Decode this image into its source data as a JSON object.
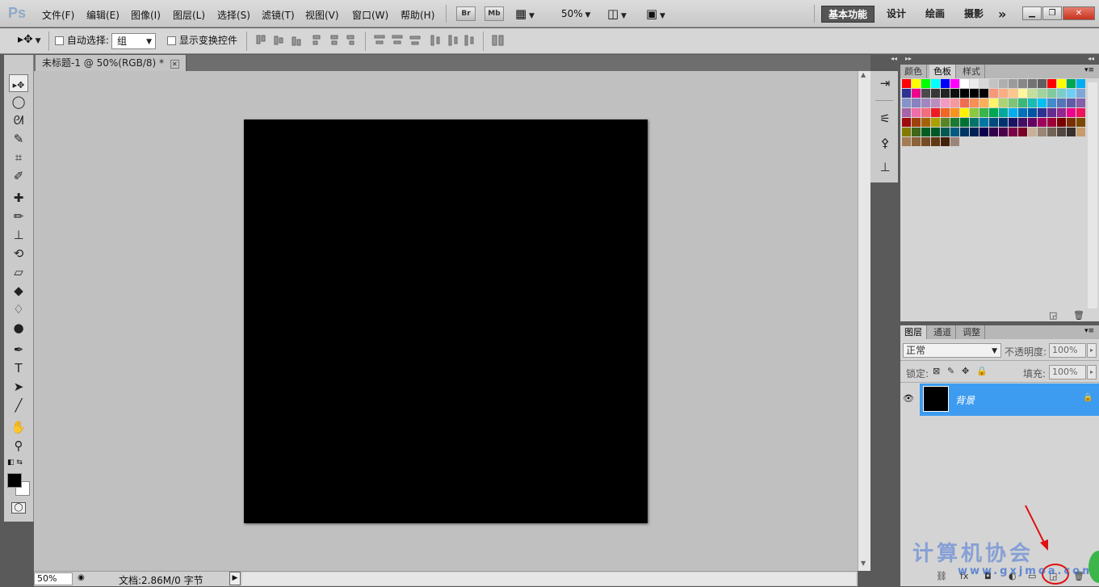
{
  "app": {
    "logo": "Ps"
  },
  "menu": [
    "文件(F)",
    "编辑(E)",
    "图像(I)",
    "图层(L)",
    "选择(S)",
    "滤镜(T)",
    "视图(V)",
    "窗口(W)",
    "帮助(H)"
  ],
  "menubar_tools": {
    "bridge": "Br",
    "mini_bridge": "Mb",
    "zoom": "50%"
  },
  "workspaces": [
    "基本功能",
    "设计",
    "绘画",
    "摄影"
  ],
  "workspace_more": "»",
  "options": {
    "auto_select_label": "自动选择:",
    "auto_select_value": "组",
    "show_transform_label": "显示变换控件"
  },
  "document": {
    "tab_label": "未标题-1 @ 50%(RGB/8) *",
    "tab_close": "✕"
  },
  "status": {
    "zoom": "50%",
    "doc_info": "文档:2.86M/0 字节"
  },
  "panels": {
    "swatch_tabs": [
      "颜色",
      "色板",
      "样式"
    ],
    "layers_tabs": [
      "图层",
      "通道",
      "调整"
    ],
    "blend_mode": "正常",
    "opacity_label": "不透明度:",
    "opacity_value": "100%",
    "lock_label": "锁定:",
    "fill_label": "填充:",
    "fill_value": "100%",
    "layer_name": "背景"
  },
  "swatch_colors": [
    "#ff0000",
    "#ffff00",
    "#00ff00",
    "#00ffff",
    "#0000ff",
    "#ff00ff",
    "#ffffff",
    "#ebebeb",
    "#d7d7d7",
    "#c3c3c3",
    "#afafaf",
    "#9b9b9b",
    "#878787",
    "#737373",
    "#5f5f5f",
    "#ff0000",
    "#ffff00",
    "#00a651",
    "#00aeef",
    "#2e3192",
    "#ec008c",
    "#4b4b4b",
    "#373737",
    "#232323",
    "#0f0f0f",
    "#000000",
    "#000000",
    "#000000",
    "#f7977a",
    "#fbad82",
    "#fdc68a",
    "#fff79a",
    "#c4df9b",
    "#a3d39c",
    "#82ca9d",
    "#7bcdc8",
    "#6ecff6",
    "#7ea7d8",
    "#8493ca",
    "#8882be",
    "#a187be",
    "#bc8dbf",
    "#f49ac2",
    "#f6989d",
    "#f26c4f",
    "#f68e55",
    "#fbaf5c",
    "#fff467",
    "#acd372",
    "#7cc576",
    "#3bb878",
    "#1abbb4",
    "#00bff3",
    "#438ccb",
    "#5574b9",
    "#605ca8",
    "#855fa8",
    "#a763a8",
    "#f06ea9",
    "#f26d7d",
    "#ed1c24",
    "#f26522",
    "#f7941d",
    "#fff200",
    "#8dc63f",
    "#39b54a",
    "#00a651",
    "#00a99d",
    "#00aeef",
    "#0072bc",
    "#0054a6",
    "#2e3192",
    "#662d91",
    "#92278f",
    "#ec008c",
    "#ed145b",
    "#9e0b0f",
    "#a0410d",
    "#a36209",
    "#aba000",
    "#598527",
    "#1a7b30",
    "#007236",
    "#00746b",
    "#0076a3",
    "#004b80",
    "#003471",
    "#1b1464",
    "#440e62",
    "#630460",
    "#9e005d",
    "#9e0039",
    "#790000",
    "#7b2e00",
    "#7d4900",
    "#827b00",
    "#406618",
    "#005e20",
    "#005826",
    "#005952",
    "#005b7f",
    "#003663",
    "#002157",
    "#0d004c",
    "#32004b",
    "#4b0049",
    "#7b0046",
    "#7a0026",
    "#c7b299",
    "#998675",
    "#736357",
    "#534741",
    "#37302d",
    "#c69c6d",
    "#a67c52",
    "#8c6239",
    "#754c24",
    "#603913",
    "#42210b",
    "#9b8579"
  ],
  "tools": [
    {
      "name": "move-tool",
      "glyph": "▸✥"
    },
    {
      "name": "marquee-tool",
      "glyph": "◯"
    },
    {
      "name": "lasso-tool",
      "glyph": "ᘛ"
    },
    {
      "name": "quick-select-tool",
      "glyph": "✎"
    },
    {
      "name": "crop-tool",
      "glyph": "⌗"
    },
    {
      "name": "eyedropper-tool",
      "glyph": "✐"
    },
    {
      "name": "healing-tool",
      "glyph": "✚"
    },
    {
      "name": "brush-tool",
      "glyph": "✏"
    },
    {
      "name": "stamp-tool",
      "glyph": "⊥"
    },
    {
      "name": "history-brush-tool",
      "glyph": "⟲"
    },
    {
      "name": "eraser-tool",
      "glyph": "▱"
    },
    {
      "name": "bucket-tool",
      "glyph": "◆"
    },
    {
      "name": "blur-tool",
      "glyph": "♢"
    },
    {
      "name": "dodge-tool",
      "glyph": "●"
    },
    {
      "name": "pen-tool",
      "glyph": "✒"
    },
    {
      "name": "type-tool",
      "glyph": "T"
    },
    {
      "name": "path-select-tool",
      "glyph": "➤"
    },
    {
      "name": "line-tool",
      "glyph": "╱"
    },
    {
      "name": "hand-tool",
      "glyph": "✋"
    },
    {
      "name": "zoom-tool",
      "glyph": "⚲"
    }
  ],
  "watermark": {
    "title": "计算机协会",
    "url": "www.gxjmoa.com"
  }
}
